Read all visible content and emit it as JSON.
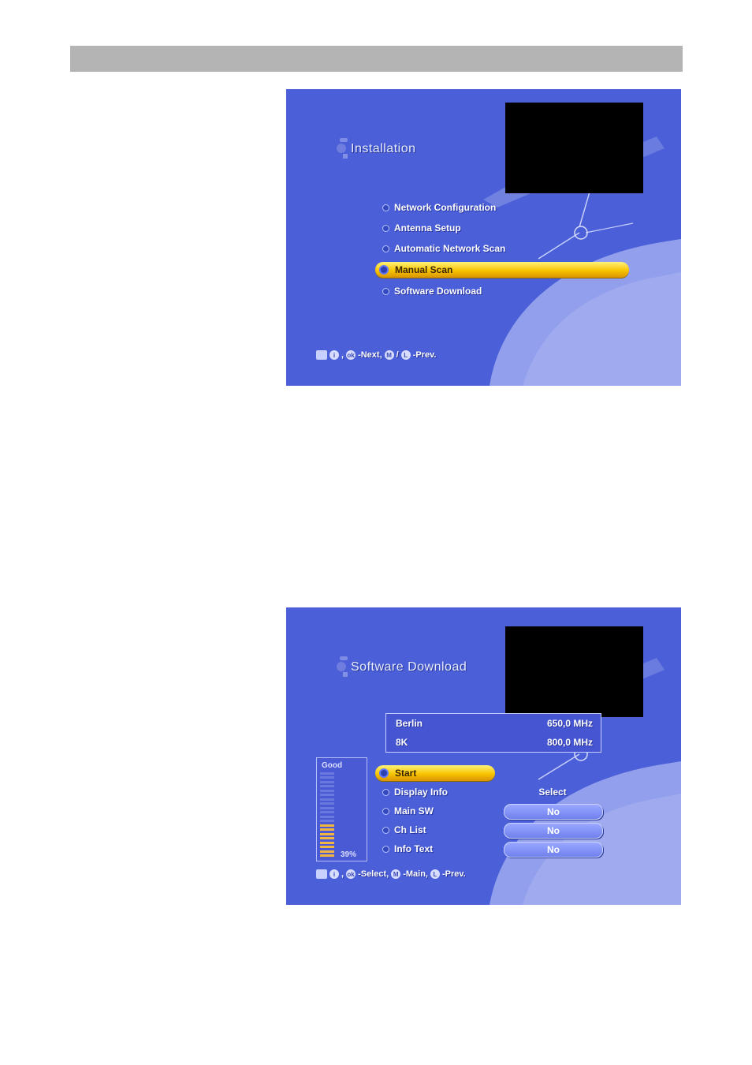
{
  "screen1": {
    "title": "Installation",
    "menu": [
      {
        "label": "Network Configuration"
      },
      {
        "label": "Antenna Setup"
      },
      {
        "label": "Automatic Network Scan"
      },
      {
        "label": "Manual Scan",
        "selected": true
      },
      {
        "label": "Software Download"
      }
    ],
    "footer": {
      "key1": "i",
      "sep1": ",",
      "key2": "ok",
      "next_label": "-Next,",
      "key3": "M",
      "sep2": "/",
      "key4": "L",
      "prev_label": "-Prev."
    }
  },
  "screen2": {
    "title": "Software Download",
    "info": [
      {
        "name": "Berlin",
        "value": "650,0 MHz"
      },
      {
        "name": "8K",
        "value": "800,0 MHz"
      }
    ],
    "signal": {
      "label": "Good",
      "percent_label": "39%",
      "level": 0.39
    },
    "menu": [
      {
        "label": "Start",
        "selected": true
      },
      {
        "label": "Display Info",
        "value": "Select"
      },
      {
        "label": "Main SW",
        "value": "No"
      },
      {
        "label": "Ch List",
        "value": "No"
      },
      {
        "label": "Info Text",
        "value": "No"
      }
    ],
    "footer": {
      "key1": "i",
      "sep1": ",",
      "key2": "ok",
      "select_label": "-Select,",
      "key3": "M",
      "main_label": "-Main,",
      "key4": "L",
      "prev_label": "-Prev."
    }
  },
  "colors": {
    "screen_bg": "#4a5fd8",
    "highlight": "#f7c400",
    "header_bar": "#b4b4b4"
  }
}
